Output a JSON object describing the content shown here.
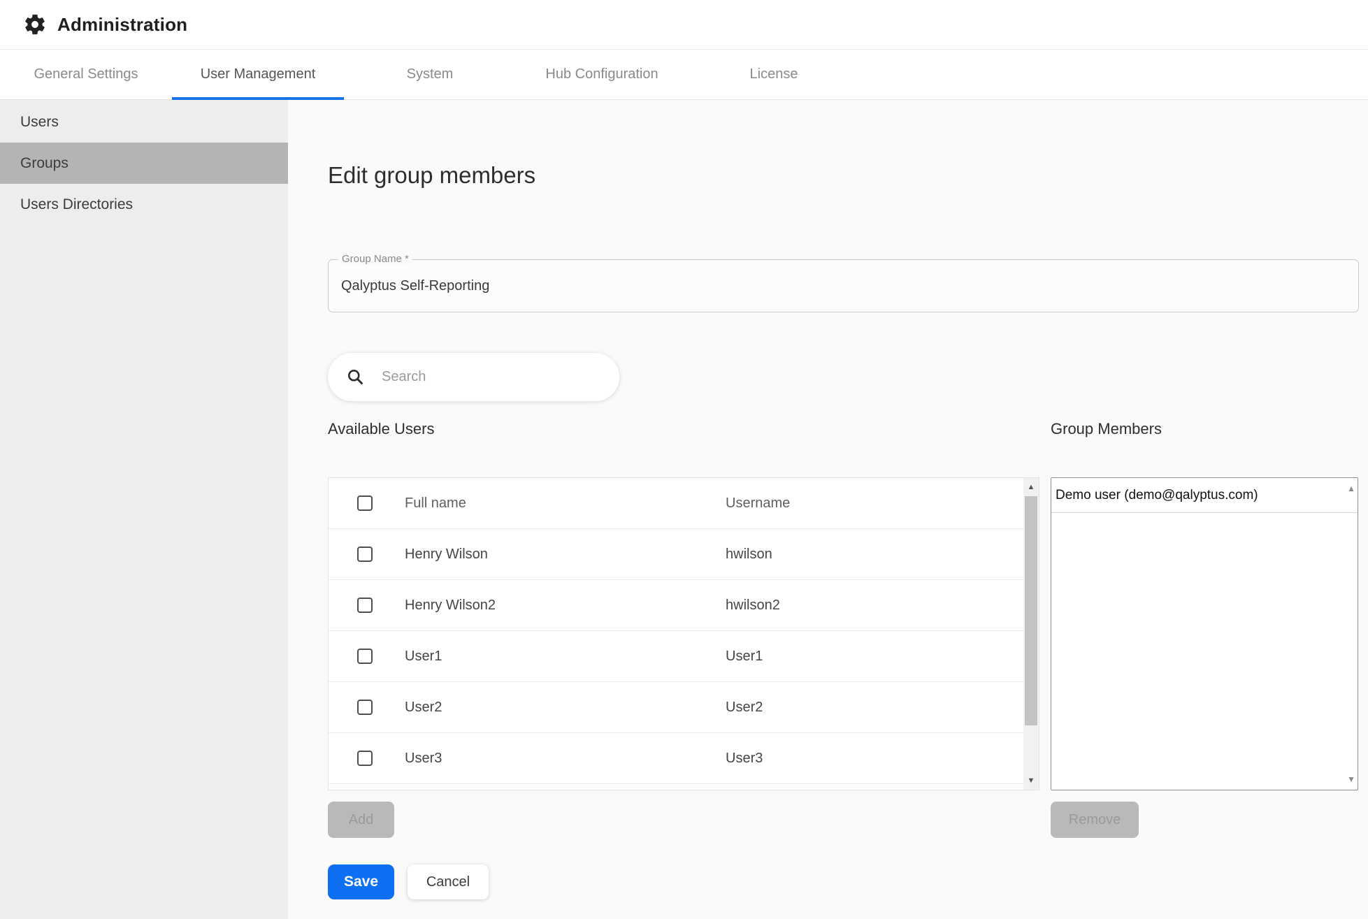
{
  "header": {
    "title": "Administration"
  },
  "tabs": [
    {
      "label": "General Settings"
    },
    {
      "label": "User Management"
    },
    {
      "label": "System"
    },
    {
      "label": "Hub Configuration"
    },
    {
      "label": "License"
    }
  ],
  "active_tab": "User Management",
  "sidebar": {
    "items": [
      {
        "label": "Users"
      },
      {
        "label": "Groups"
      },
      {
        "label": "Users Directories"
      }
    ],
    "selected": "Groups"
  },
  "main": {
    "heading": "Edit group members",
    "group_name": {
      "label": "Group Name *",
      "value": "Qalyptus Self-Reporting"
    },
    "search": {
      "placeholder": "Search"
    },
    "available_users": {
      "title": "Available Users",
      "columns": {
        "full_name": "Full name",
        "username": "Username"
      },
      "rows": [
        {
          "full_name": "Henry Wilson",
          "username": "hwilson"
        },
        {
          "full_name": "Henry Wilson2",
          "username": "hwilson2"
        },
        {
          "full_name": "User1",
          "username": "User1"
        },
        {
          "full_name": "User2",
          "username": "User2"
        },
        {
          "full_name": "User3",
          "username": "User3"
        }
      ]
    },
    "group_members": {
      "title": "Group Members",
      "options": [
        "Demo user (demo@qalyptus.com)"
      ]
    },
    "buttons": {
      "add": "Add",
      "remove": "Remove",
      "save": "Save",
      "cancel": "Cancel"
    }
  },
  "colors": {
    "accent_blue": "#0d6ff2",
    "tab_underline": "#1673e8",
    "sidebar_bg": "#ededed",
    "sidebar_selected": "#b4b4b4",
    "disabled_button_bg": "#b9b9b9",
    "main_bg": "#fafafa"
  }
}
